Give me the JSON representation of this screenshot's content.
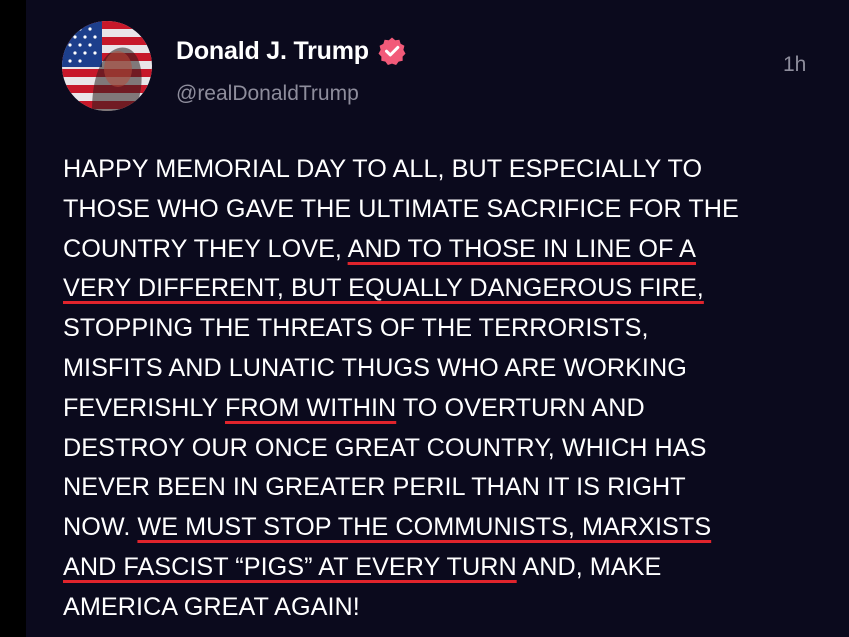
{
  "post": {
    "author": {
      "display_name": "Donald J. Trump",
      "handle": "@realDonaldTrump",
      "verified_icon": "verified-badge-icon",
      "avatar_icon": "profile-avatar-flag-icon"
    },
    "timestamp": "1h",
    "text_lines": [
      [
        {
          "t": "HAPPY MEMORIAL DAY TO ALL, BUT ESPECIALLY TO",
          "u": false
        }
      ],
      [
        {
          "t": "THOSE WHO GAVE THE ULTIMATE SACRIFICE FOR THE",
          "u": false
        }
      ],
      [
        {
          "t": "COUNTRY THEY LOVE, ",
          "u": false
        },
        {
          "t": "AND TO THOSE IN LINE OF A",
          "u": true
        }
      ],
      [
        {
          "t": "VERY DIFFERENT, BUT EQUALLY DANGEROUS FIRE,",
          "u": true
        }
      ],
      [
        {
          "t": "STOPPING THE THREATS OF THE TERRORISTS,",
          "u": false
        }
      ],
      [
        {
          "t": "MISFITS AND LUNATIC THUGS WHO ARE WORKING",
          "u": false
        }
      ],
      [
        {
          "t": "FEVERISHLY ",
          "u": false
        },
        {
          "t": "FROM WITHIN",
          "u": true
        },
        {
          "t": " TO OVERTURN AND",
          "u": false
        }
      ],
      [
        {
          "t": "DESTROY OUR ONCE GREAT COUNTRY, WHICH HAS",
          "u": false
        }
      ],
      [
        {
          "t": "NEVER BEEN IN GREATER PERIL THAN IT IS RIGHT",
          "u": false
        }
      ],
      [
        {
          "t": "NOW. ",
          "u": false
        },
        {
          "t": "WE MUST STOP THE COMMUNISTS, MARXISTS",
          "u": true
        }
      ],
      [
        {
          "t": "AND FASCIST “PIGS” AT EVERY TURN",
          "u": true
        },
        {
          "t": " AND, MAKE",
          "u": false
        }
      ],
      [
        {
          "t": "AMERICA GREAT AGAIN!",
          "u": false
        }
      ]
    ]
  },
  "colors": {
    "background": "#0b0a1d",
    "outer": "#000000",
    "text": "#ffffff",
    "muted": "#8e8d9c",
    "underline": "#e0242c",
    "verified": "#f25a79"
  }
}
